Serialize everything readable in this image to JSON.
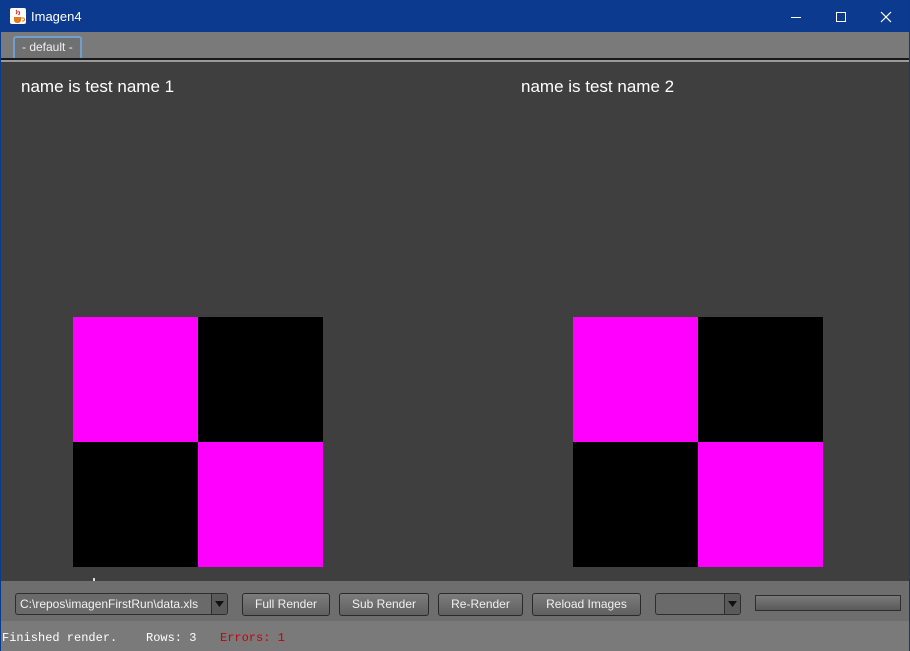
{
  "window": {
    "title": "Imagen4",
    "icon": "java-cup-icon",
    "controls": [
      "minimize-icon",
      "maximize-icon",
      "close-icon"
    ]
  },
  "tabs": [
    {
      "label": "- default -",
      "selected": true
    }
  ],
  "canvas": {
    "cards": [
      {
        "label": "name is test name 1",
        "pattern": [
          "#ff00ff",
          "#000000",
          "#000000",
          "#ff00ff"
        ]
      },
      {
        "label": "name is test name 2",
        "pattern": [
          "#ff00ff",
          "#000000",
          "#000000",
          "#ff00ff"
        ]
      }
    ]
  },
  "toolbar": {
    "data_file": "C:\\repos\\imagenFirstRun\\data.xls",
    "buttons": {
      "full_render": "Full Render",
      "sub_render": "Sub Render",
      "re_render": "Re-Render",
      "reload_images": "Reload Images"
    },
    "selector_value": ""
  },
  "status": {
    "message": "Finished render.",
    "rows": "Rows: 3",
    "errors": "Errors: 1"
  },
  "colors": {
    "title_bar": "#0b3a8e",
    "canvas_bg": "#3f3f3f",
    "magenta": "#ff00ff",
    "black": "#000000",
    "error_text": "#c8000a"
  }
}
